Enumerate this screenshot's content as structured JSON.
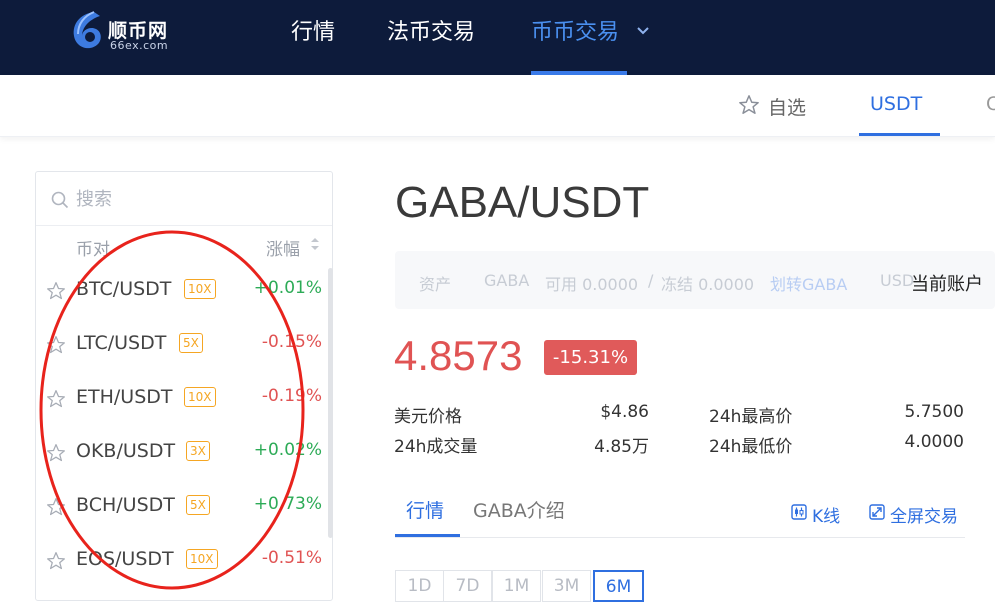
{
  "brand": {
    "name": "顺币网",
    "domain": "66ex.com"
  },
  "nav": {
    "items": [
      "行情",
      "法币交易",
      "币币交易"
    ],
    "active_index": 2
  },
  "subnav": {
    "favorites_label": "自选",
    "active_tab": "USDT",
    "cut_tab": "C"
  },
  "search": {
    "placeholder": "搜索"
  },
  "pair_list": {
    "col_pair": "币对",
    "col_change": "涨幅",
    "rows": [
      {
        "pair": "BTC/USDT",
        "leverage": "10X",
        "change": "+0.01%",
        "dir": "up"
      },
      {
        "pair": "LTC/USDT",
        "leverage": "5X",
        "change": "-0.15%",
        "dir": "down"
      },
      {
        "pair": "ETH/USDT",
        "leverage": "10X",
        "change": "-0.19%",
        "dir": "down"
      },
      {
        "pair": "OKB/USDT",
        "leverage": "3X",
        "change": "+0.02%",
        "dir": "up"
      },
      {
        "pair": "BCH/USDT",
        "leverage": "5X",
        "change": "+0.73%",
        "dir": "up"
      },
      {
        "pair": "EOS/USDT",
        "leverage": "10X",
        "change": "-0.51%",
        "dir": "down"
      }
    ]
  },
  "market": {
    "title": "GABA/USDT",
    "asset_bar": {
      "label": "资产",
      "coin": "GABA",
      "available": "可用 0.0000",
      "sep": "/",
      "frozen": "冻结 0.0000",
      "transfer": "划转GABA",
      "cut_coin": "USD",
      "account": "当前账户"
    },
    "price": "4.8573",
    "change_pct": "-15.31%",
    "stats": {
      "usd_price_label": "美元价格",
      "usd_price": "$4.86",
      "high_label": "24h最高价",
      "high": "5.7500",
      "volume_label": "24h成交量",
      "volume": "4.85万",
      "low_label": "24h最低价",
      "low": "4.0000"
    },
    "tabs": [
      "行情",
      "GABA介绍"
    ],
    "kline_label": "K线",
    "fullscreen_label": "全屏交易",
    "periods": [
      "1D",
      "7D",
      "1M",
      "3M",
      "6M"
    ],
    "active_period": "6M"
  },
  "colors": {
    "nav_bg": "#0d1b3b",
    "accent": "#2f6fe0",
    "up": "#2dab57",
    "down": "#e05353",
    "leverage": "#f5a623",
    "annotation": "#e8231c"
  },
  "icons": [
    "logo-mark",
    "chevron-down-icon",
    "star-outline-icon",
    "search-icon",
    "sort-icon",
    "kline-icon",
    "fullscreen-icon"
  ]
}
